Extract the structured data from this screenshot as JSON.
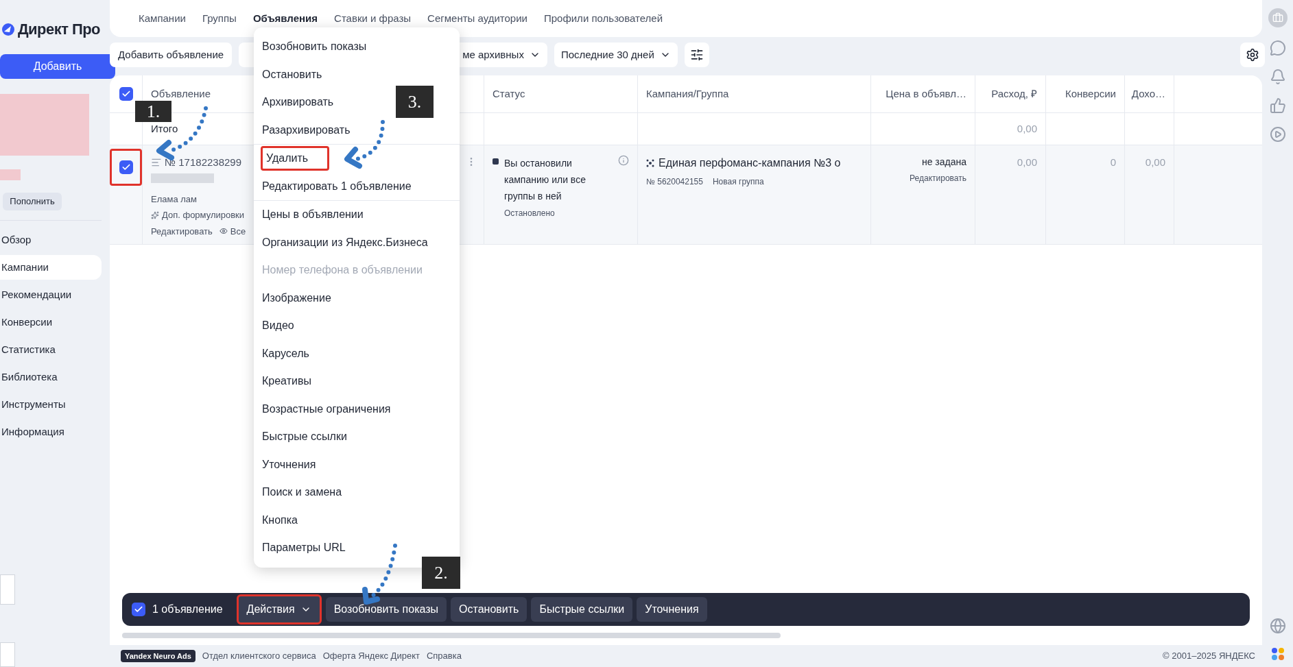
{
  "logo": {
    "text": "Директ Про"
  },
  "sidebar": {
    "add_button": "Добавить",
    "top_up_button": "Пополнить",
    "items": [
      {
        "label": "Обзор",
        "selected": false
      },
      {
        "label": "Кампании",
        "selected": true
      },
      {
        "label": "Рекомендации",
        "selected": false
      },
      {
        "label": "Конверсии",
        "selected": false
      },
      {
        "label": "Статистика",
        "selected": false
      },
      {
        "label": "Библиотека",
        "selected": false
      },
      {
        "label": "Инструменты",
        "selected": false
      },
      {
        "label": "Информация",
        "selected": false
      }
    ]
  },
  "nav_tabs": [
    {
      "label": "Кампании",
      "selected": false
    },
    {
      "label": "Группы",
      "selected": false
    },
    {
      "label": "Объявления",
      "selected": true
    },
    {
      "label": "Ставки и фразы",
      "selected": false
    },
    {
      "label": "Сегменты аудитории",
      "selected": false
    },
    {
      "label": "Профили пользователей",
      "selected": false
    }
  ],
  "toolbar": {
    "add_ad_button": "Добавить объявление",
    "archive_filter": "ме архивных",
    "period_filter": "Последние 30 дней"
  },
  "table": {
    "header_checked": true,
    "columns": [
      "Объявление",
      "Статус",
      "Кампания/Группа",
      "Цена в объявл…",
      "Расход, ₽",
      "Конверсии",
      "Дохо…"
    ],
    "totals": {
      "label": "Итого",
      "expense": "0,00"
    },
    "rows": [
      {
        "checked": true,
        "highlighted": true,
        "ad_number": "№ 17182238299",
        "title": "Елама лам",
        "extra": "Доп. формулировки",
        "edit_link": "Редактировать",
        "view_link": "Все",
        "status": "Вы остановили кампанию или все группы в ней",
        "status_sub": "Остановлено",
        "campaign": "Единая перфоманс-кампания №3 о",
        "group_number": "№ 5620042155",
        "group_name": "Новая группа",
        "price": "не задана",
        "price_edit": "Редактировать",
        "expense": "0,00",
        "conversions": "0",
        "income": "0,00"
      }
    ]
  },
  "action_menu": {
    "groups": [
      [
        {
          "label": "Возобновить показы",
          "disabled": false,
          "highlighted": false
        },
        {
          "label": "Остановить",
          "disabled": false,
          "highlighted": false
        },
        {
          "label": "Архивировать",
          "disabled": false,
          "highlighted": false
        },
        {
          "label": "Разархивировать",
          "disabled": false,
          "highlighted": false
        }
      ],
      [
        {
          "label": "Удалить",
          "disabled": false,
          "highlighted": true
        },
        {
          "label": "Редактировать 1 объявление",
          "disabled": false,
          "highlighted": false
        }
      ],
      [
        {
          "label": "Цены в объявлении",
          "disabled": false,
          "highlighted": false
        },
        {
          "label": "Организации из Яндекс.Бизнеса",
          "disabled": false,
          "highlighted": false
        },
        {
          "label": "Номер телефона в объявлении",
          "disabled": true,
          "highlighted": false
        },
        {
          "label": "Изображение",
          "disabled": false,
          "highlighted": false
        },
        {
          "label": "Видео",
          "disabled": false,
          "highlighted": false
        },
        {
          "label": "Карусель",
          "disabled": false,
          "highlighted": false
        },
        {
          "label": "Креативы",
          "disabled": false,
          "highlighted": false
        },
        {
          "label": "Возрастные ограничения",
          "disabled": false,
          "highlighted": false
        },
        {
          "label": "Быстрые ссылки",
          "disabled": false,
          "highlighted": false
        },
        {
          "label": "Уточнения",
          "disabled": false,
          "highlighted": false
        },
        {
          "label": "Поиск и замена",
          "disabled": false,
          "highlighted": false
        },
        {
          "label": "Кнопка",
          "disabled": false,
          "highlighted": false
        },
        {
          "label": "Параметры URL",
          "disabled": false,
          "highlighted": false
        }
      ]
    ]
  },
  "bulk_bar": {
    "checked": true,
    "count": "1 объявление",
    "actions_button": {
      "label": "Действия",
      "highlighted": true
    },
    "buttons": [
      "Возобновить показы",
      "Остановить",
      "Быстрые ссылки",
      "Уточнения"
    ]
  },
  "footer": {
    "badge": "Yandex Neuro Ads",
    "links": [
      "Отдел клиентского сервиса",
      "Оферта Яндекс Директ",
      "Справка"
    ],
    "copyright": "© 2001–2025 ЯНДЕКС"
  },
  "annotations": [
    {
      "label": "1."
    },
    {
      "label": "2."
    },
    {
      "label": "3."
    }
  ]
}
